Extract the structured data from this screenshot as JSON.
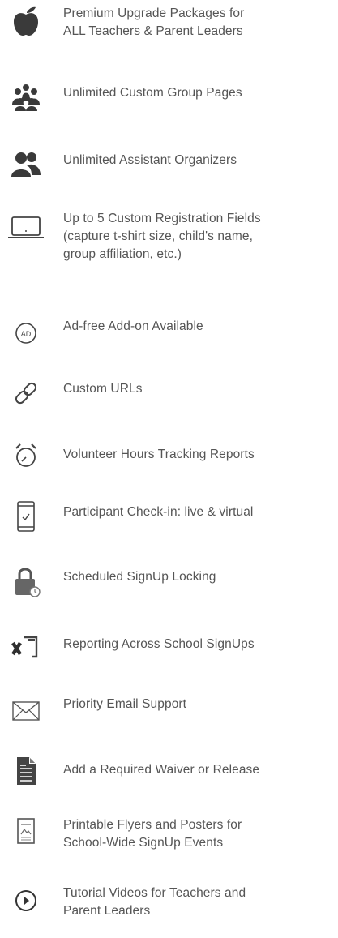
{
  "features": [
    {
      "icon": "apple-icon",
      "lines": [
        "Premium Upgrade Packages for",
        "ALL Teachers & Parent Leaders"
      ]
    },
    {
      "icon": "group-icon",
      "lines": [
        "Unlimited Custom Group Pages"
      ]
    },
    {
      "icon": "users-icon",
      "lines": [
        "Unlimited Assistant Organizers"
      ]
    },
    {
      "icon": "laptop-icon",
      "lines": [
        "Up to 5 Custom Registration Fields",
        "(capture t-shirt size, child's name,",
        "group affiliation, etc.)"
      ]
    },
    {
      "icon": "ad-free-icon",
      "lines": [
        "Ad-free Add-on Available"
      ]
    },
    {
      "icon": "link-icon",
      "lines": [
        "Custom URLs"
      ]
    },
    {
      "icon": "alarm-clock-icon",
      "lines": [
        "Volunteer Hours Tracking Reports"
      ]
    },
    {
      "icon": "phone-checkmark-icon",
      "lines": [
        "Participant Check-in: live & virtual"
      ]
    },
    {
      "icon": "lock-clock-icon",
      "lines": [
        "Scheduled SignUp Locking"
      ]
    },
    {
      "icon": "excel-icon",
      "lines": [
        "Reporting Across School SignUps"
      ]
    },
    {
      "icon": "envelope-icon",
      "lines": [
        "Priority Email Support"
      ]
    },
    {
      "icon": "document-icon",
      "lines": [
        "Add a Required Waiver or Release"
      ]
    },
    {
      "icon": "flyer-icon",
      "lines": [
        "Printable Flyers and Posters for",
        "School-Wide SignUp Events"
      ]
    },
    {
      "icon": "play-icon",
      "lines": [
        "Tutorial Videos for Teachers and",
        "Parent Leaders"
      ]
    }
  ],
  "icon_color": "#444444"
}
